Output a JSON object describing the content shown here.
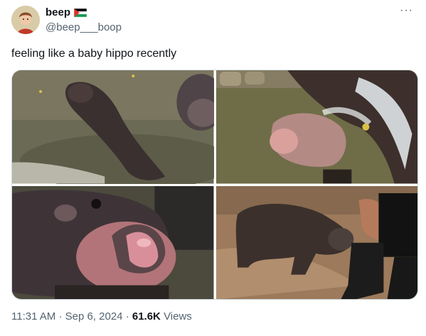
{
  "author": {
    "display_name": "beep",
    "handle": "@beep___boop",
    "flag_icon": "palestine-flag-icon",
    "avatar_icon": "cartoon-avatar"
  },
  "tweet": {
    "text": "feeling like a baby hippo recently"
  },
  "media": [
    {
      "icon": "hippo-crawling-photo"
    },
    {
      "icon": "hippo-water-spray-photo"
    },
    {
      "icon": "hippo-open-mouth-photo"
    },
    {
      "icon": "hippo-with-boot-photo"
    }
  ],
  "meta": {
    "time": "11:31 AM",
    "separator": "·",
    "date": "Sep 6, 2024",
    "views_count": "61.6K",
    "views_label": "Views"
  },
  "more_icon": "more-options-icon",
  "colors": {
    "text_primary": "#0f1419",
    "text_secondary": "#536471",
    "border": "#cfd9de",
    "background": "#ffffff"
  }
}
